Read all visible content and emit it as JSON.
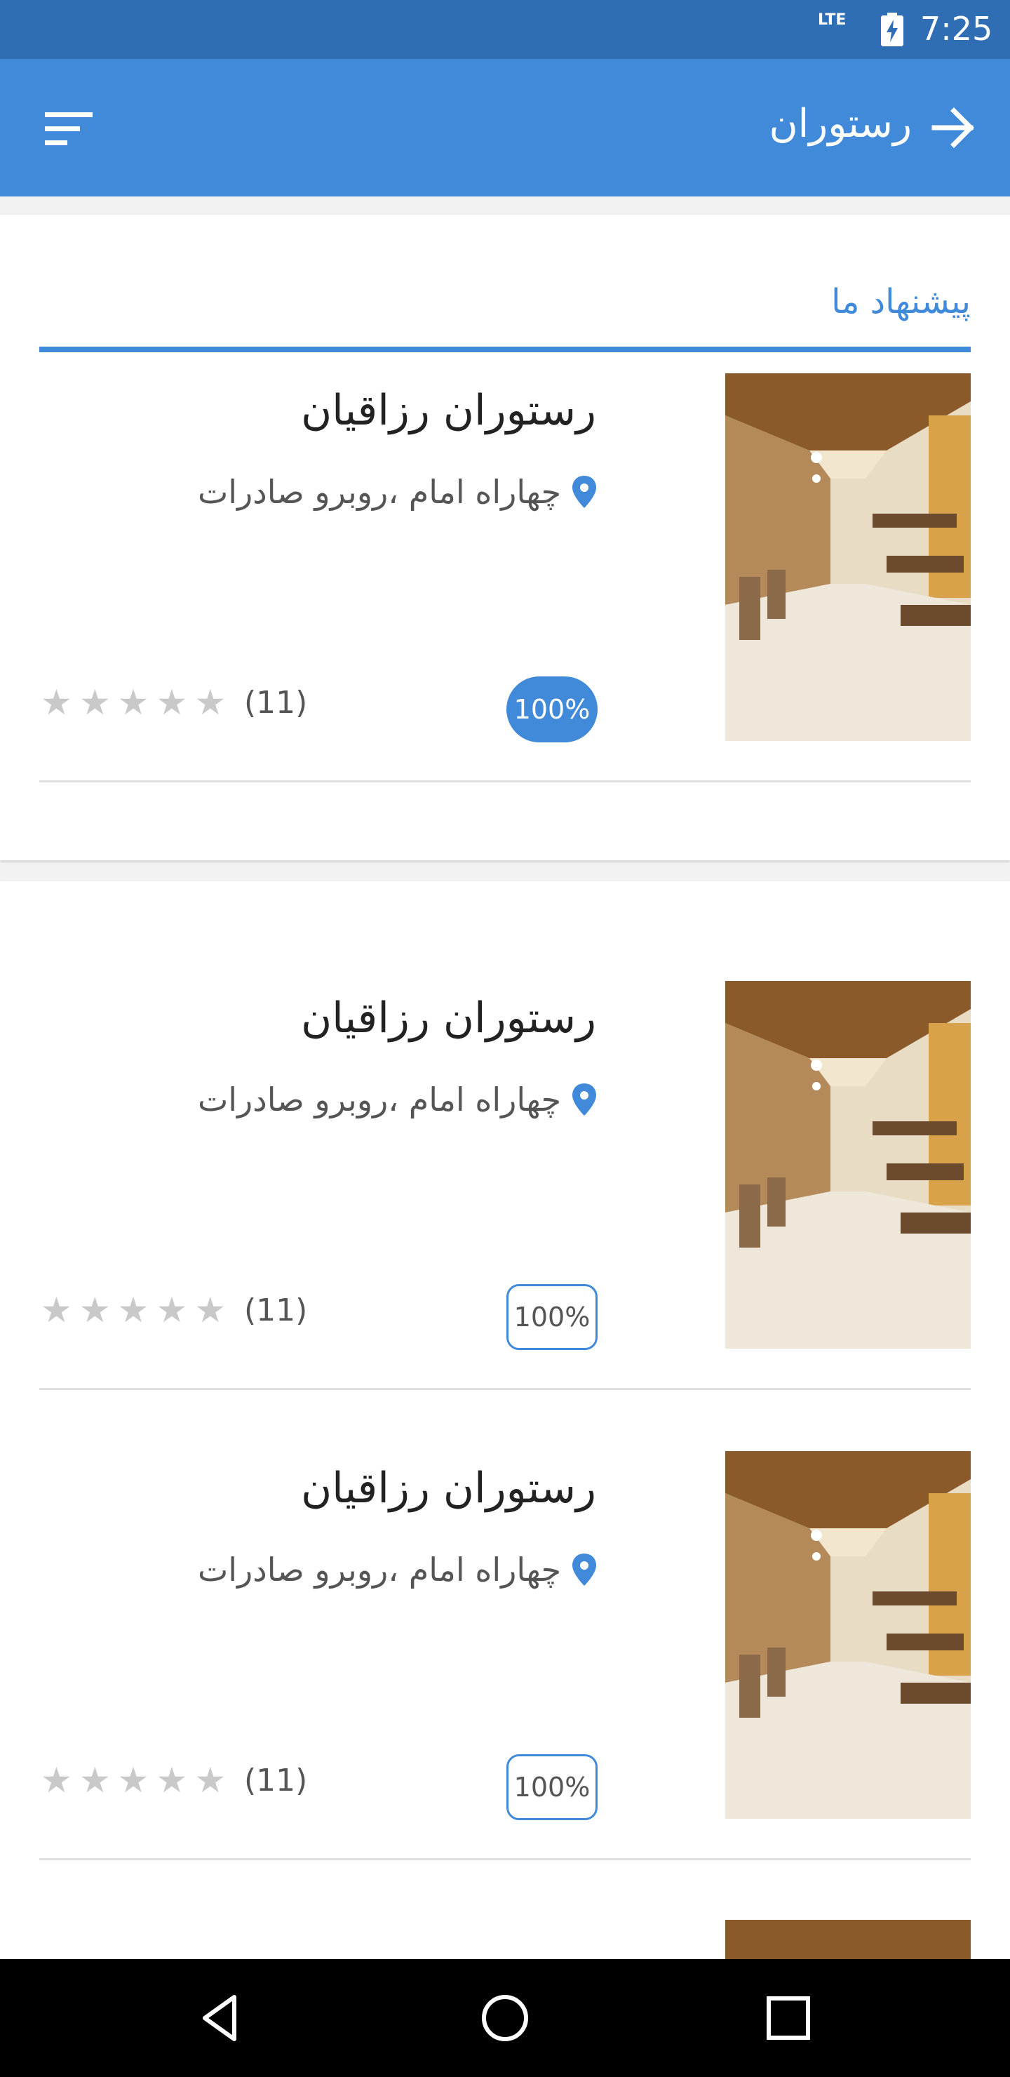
{
  "status_bar": {
    "network": "LTE",
    "time": "7:25"
  },
  "app_bar": {
    "title": "رستوران",
    "back_icon": "arrow-right-icon",
    "menu_icon": "sort-menu-icon"
  },
  "colors": {
    "primary": "#4189d9",
    "status_bar": "#2f6db4",
    "star_inactive": "#c9c9c9"
  },
  "section": {
    "title": "پیشنهاد ما"
  },
  "restaurants": [
    {
      "name": "رستوران رزاقیان",
      "address": "چهاراه امام ،روبرو صادرات",
      "badge": "100%",
      "badge_style": "filled",
      "rating": 0,
      "rating_count": "(11)"
    },
    {
      "name": "رستوران رزاقیان",
      "address": "چهاراه امام ،روبرو صادرات",
      "badge": "100%",
      "badge_style": "outlined",
      "rating": 0,
      "rating_count": "(11)"
    },
    {
      "name": "رستوران رزاقیان",
      "address": "چهاراه امام ،روبرو صادرات",
      "badge": "100%",
      "badge_style": "outlined",
      "rating": 0,
      "rating_count": "(11)"
    }
  ],
  "nav_bar": {
    "icons": [
      "back-triangle-icon",
      "home-circle-icon",
      "recents-square-icon"
    ]
  }
}
